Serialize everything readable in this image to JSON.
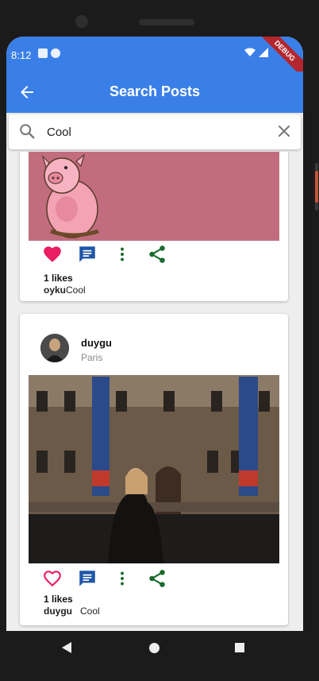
{
  "status_bar": {
    "time": "8:12",
    "debug_label": "DEBUG"
  },
  "app_bar": {
    "title": "Search Posts"
  },
  "search": {
    "value": "Cool",
    "placeholder": ""
  },
  "posts": [
    {
      "likes_label": "1 likes",
      "caption_user": "oyku",
      "caption_text": "Cool",
      "liked": true
    },
    {
      "username": "duygu",
      "location": "Paris",
      "likes_label": "1 likes",
      "caption_user": "duygu",
      "caption_text": "Cool",
      "liked": false
    }
  ],
  "colors": {
    "primary": "#3a7fe8",
    "like_red": "#e91e63",
    "comment_blue": "#1f56a8",
    "share_green": "#1b6b2d",
    "pink_image_bg": "#c16d7e"
  },
  "icons": [
    "back-arrow-icon",
    "search-icon",
    "close-icon",
    "heart-icon",
    "comment-icon",
    "more-vert-icon",
    "share-icon"
  ]
}
